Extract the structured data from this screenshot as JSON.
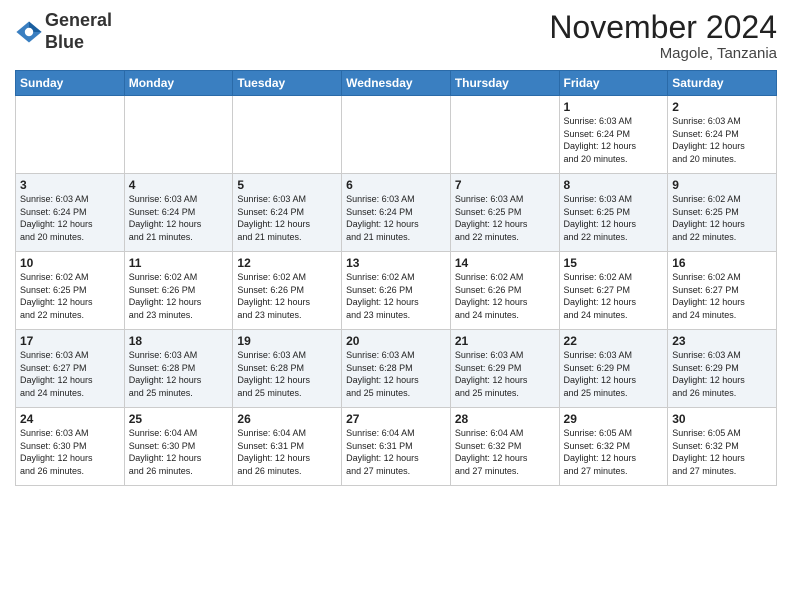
{
  "header": {
    "logo_line1": "General",
    "logo_line2": "Blue",
    "month_title": "November 2024",
    "location": "Magole, Tanzania"
  },
  "weekdays": [
    "Sunday",
    "Monday",
    "Tuesday",
    "Wednesday",
    "Thursday",
    "Friday",
    "Saturday"
  ],
  "weeks": [
    [
      {
        "day": "",
        "info": ""
      },
      {
        "day": "",
        "info": ""
      },
      {
        "day": "",
        "info": ""
      },
      {
        "day": "",
        "info": ""
      },
      {
        "day": "",
        "info": ""
      },
      {
        "day": "1",
        "info": "Sunrise: 6:03 AM\nSunset: 6:24 PM\nDaylight: 12 hours\nand 20 minutes."
      },
      {
        "day": "2",
        "info": "Sunrise: 6:03 AM\nSunset: 6:24 PM\nDaylight: 12 hours\nand 20 minutes."
      }
    ],
    [
      {
        "day": "3",
        "info": "Sunrise: 6:03 AM\nSunset: 6:24 PM\nDaylight: 12 hours\nand 20 minutes."
      },
      {
        "day": "4",
        "info": "Sunrise: 6:03 AM\nSunset: 6:24 PM\nDaylight: 12 hours\nand 21 minutes."
      },
      {
        "day": "5",
        "info": "Sunrise: 6:03 AM\nSunset: 6:24 PM\nDaylight: 12 hours\nand 21 minutes."
      },
      {
        "day": "6",
        "info": "Sunrise: 6:03 AM\nSunset: 6:24 PM\nDaylight: 12 hours\nand 21 minutes."
      },
      {
        "day": "7",
        "info": "Sunrise: 6:03 AM\nSunset: 6:25 PM\nDaylight: 12 hours\nand 22 minutes."
      },
      {
        "day": "8",
        "info": "Sunrise: 6:03 AM\nSunset: 6:25 PM\nDaylight: 12 hours\nand 22 minutes."
      },
      {
        "day": "9",
        "info": "Sunrise: 6:02 AM\nSunset: 6:25 PM\nDaylight: 12 hours\nand 22 minutes."
      }
    ],
    [
      {
        "day": "10",
        "info": "Sunrise: 6:02 AM\nSunset: 6:25 PM\nDaylight: 12 hours\nand 22 minutes."
      },
      {
        "day": "11",
        "info": "Sunrise: 6:02 AM\nSunset: 6:26 PM\nDaylight: 12 hours\nand 23 minutes."
      },
      {
        "day": "12",
        "info": "Sunrise: 6:02 AM\nSunset: 6:26 PM\nDaylight: 12 hours\nand 23 minutes."
      },
      {
        "day": "13",
        "info": "Sunrise: 6:02 AM\nSunset: 6:26 PM\nDaylight: 12 hours\nand 23 minutes."
      },
      {
        "day": "14",
        "info": "Sunrise: 6:02 AM\nSunset: 6:26 PM\nDaylight: 12 hours\nand 24 minutes."
      },
      {
        "day": "15",
        "info": "Sunrise: 6:02 AM\nSunset: 6:27 PM\nDaylight: 12 hours\nand 24 minutes."
      },
      {
        "day": "16",
        "info": "Sunrise: 6:02 AM\nSunset: 6:27 PM\nDaylight: 12 hours\nand 24 minutes."
      }
    ],
    [
      {
        "day": "17",
        "info": "Sunrise: 6:03 AM\nSunset: 6:27 PM\nDaylight: 12 hours\nand 24 minutes."
      },
      {
        "day": "18",
        "info": "Sunrise: 6:03 AM\nSunset: 6:28 PM\nDaylight: 12 hours\nand 25 minutes."
      },
      {
        "day": "19",
        "info": "Sunrise: 6:03 AM\nSunset: 6:28 PM\nDaylight: 12 hours\nand 25 minutes."
      },
      {
        "day": "20",
        "info": "Sunrise: 6:03 AM\nSunset: 6:28 PM\nDaylight: 12 hours\nand 25 minutes."
      },
      {
        "day": "21",
        "info": "Sunrise: 6:03 AM\nSunset: 6:29 PM\nDaylight: 12 hours\nand 25 minutes."
      },
      {
        "day": "22",
        "info": "Sunrise: 6:03 AM\nSunset: 6:29 PM\nDaylight: 12 hours\nand 25 minutes."
      },
      {
        "day": "23",
        "info": "Sunrise: 6:03 AM\nSunset: 6:29 PM\nDaylight: 12 hours\nand 26 minutes."
      }
    ],
    [
      {
        "day": "24",
        "info": "Sunrise: 6:03 AM\nSunset: 6:30 PM\nDaylight: 12 hours\nand 26 minutes."
      },
      {
        "day": "25",
        "info": "Sunrise: 6:04 AM\nSunset: 6:30 PM\nDaylight: 12 hours\nand 26 minutes."
      },
      {
        "day": "26",
        "info": "Sunrise: 6:04 AM\nSunset: 6:31 PM\nDaylight: 12 hours\nand 26 minutes."
      },
      {
        "day": "27",
        "info": "Sunrise: 6:04 AM\nSunset: 6:31 PM\nDaylight: 12 hours\nand 27 minutes."
      },
      {
        "day": "28",
        "info": "Sunrise: 6:04 AM\nSunset: 6:32 PM\nDaylight: 12 hours\nand 27 minutes."
      },
      {
        "day": "29",
        "info": "Sunrise: 6:05 AM\nSunset: 6:32 PM\nDaylight: 12 hours\nand 27 minutes."
      },
      {
        "day": "30",
        "info": "Sunrise: 6:05 AM\nSunset: 6:32 PM\nDaylight: 12 hours\nand 27 minutes."
      }
    ]
  ]
}
